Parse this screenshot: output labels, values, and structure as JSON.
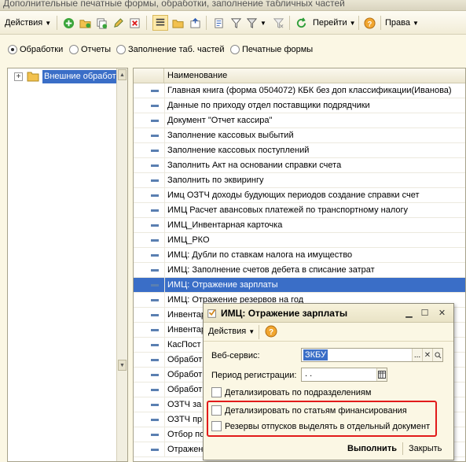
{
  "window": {
    "title": "Дополнительные печатные формы, обработки, заполнение табличных частей"
  },
  "toolbar": {
    "actions_label": "Действия",
    "go_label": "Перейти",
    "rights_label": "Права"
  },
  "filter": {
    "options": [
      {
        "label": "Обработки",
        "selected": true
      },
      {
        "label": "Отчеты",
        "selected": false
      },
      {
        "label": "Заполнение таб. частей",
        "selected": false
      },
      {
        "label": "Печатные формы",
        "selected": false
      }
    ]
  },
  "tree": {
    "root_label": "Внешние обработки"
  },
  "list": {
    "column_name": "Наименование",
    "rows": [
      "Главная книга (форма 0504072) КБК без доп классификации(Иванова)",
      "Данные по приходу отдел поставщики подрядчики",
      "Документ \"Отчет кассира\"",
      "Заполнение кассовых выбытий",
      "Заполнение кассовых поступлений",
      "Заполнить Акт на основании справки счета",
      "Заполнить по эквирингу",
      "Имц ОЗТЧ доходы будующих периодов создание справки счет",
      "ИМЦ Расчет авансовых платежей по транспортному налогу",
      "ИМЦ_Инвентарная карточка",
      "ИМЦ_РКО",
      "ИМЦ: Дубли по ставкам налога на имущество",
      "ИМЦ: Заполнение счетов дебета в списание затрат",
      "ИМЦ: Отражение зарплаты",
      "ИМЦ: Отражение резервов на год",
      "Инвентар",
      "Инвентар",
      "КасПост",
      "Обработ",
      "Обработ",
      "Обработ",
      "ОЗТЧ за",
      "ОЗТЧ пр",
      "Отбор по",
      "Отражен"
    ],
    "selected_index": 13
  },
  "dialog": {
    "title": "ИМЦ: Отражение зарплаты",
    "actions_label": "Действия",
    "web_service_label": "Веб-сервис:",
    "web_service_value": "ЗКБУ",
    "period_label": "Период регистрации:",
    "period_value": " .  .",
    "check_subdivisions": "Детализировать по подразделениям",
    "check_financing": "Детализировать по статьям финансирования",
    "check_reserves": "Резервы отпусков выделять в отдельный документ",
    "execute_label": "Выполнить",
    "close_label": "Закрыть"
  },
  "colors": {
    "selection": "#3a6ec7",
    "highlight_box": "#e11b1b",
    "background": "#fbf7e4"
  }
}
